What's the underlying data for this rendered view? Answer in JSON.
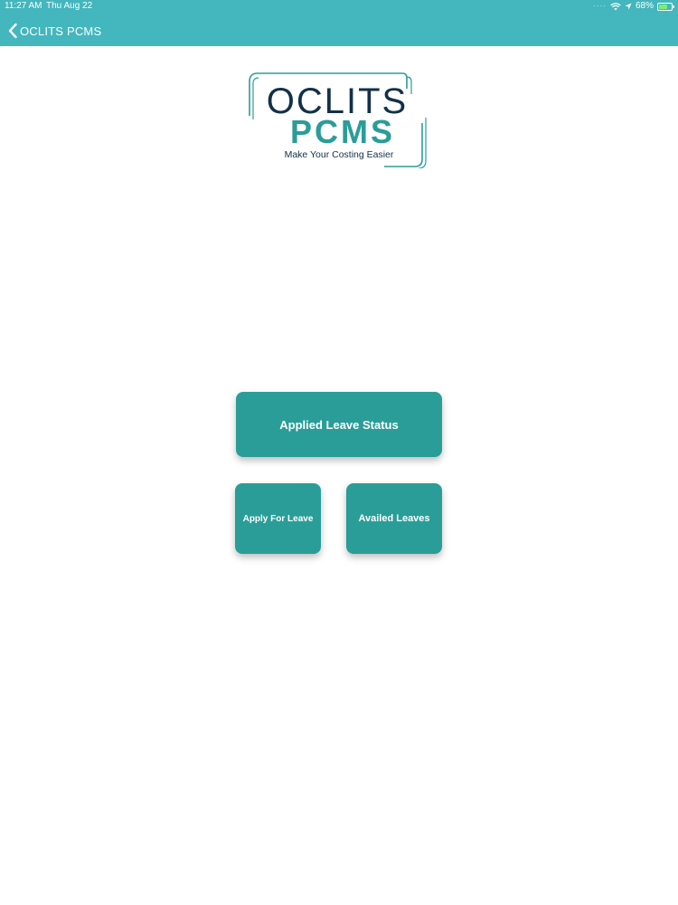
{
  "status_bar": {
    "time": "11:27 AM",
    "date": "Thu Aug 22",
    "battery": "68%",
    "battery_level": 0.68
  },
  "header": {
    "back_label": "OCLITS PCMS",
    "color": "#44b6bd"
  },
  "logo": {
    "line1": "OCLITS",
    "line2": "PCMS",
    "tagline": "Make Your Costing Easier",
    "colors": {
      "dark": "#123049",
      "teal": "#2a9d98"
    }
  },
  "buttons": {
    "applied_status": "Applied Leave Status",
    "apply_for_leave": "Apply For Leave",
    "availed_leaves": "Availed Leaves",
    "color": "#2a9d98"
  },
  "icons": {
    "back": "chevron-left-icon",
    "wifi": "wifi-icon",
    "location": "location-arrow-icon",
    "battery": "battery-charging-icon"
  }
}
